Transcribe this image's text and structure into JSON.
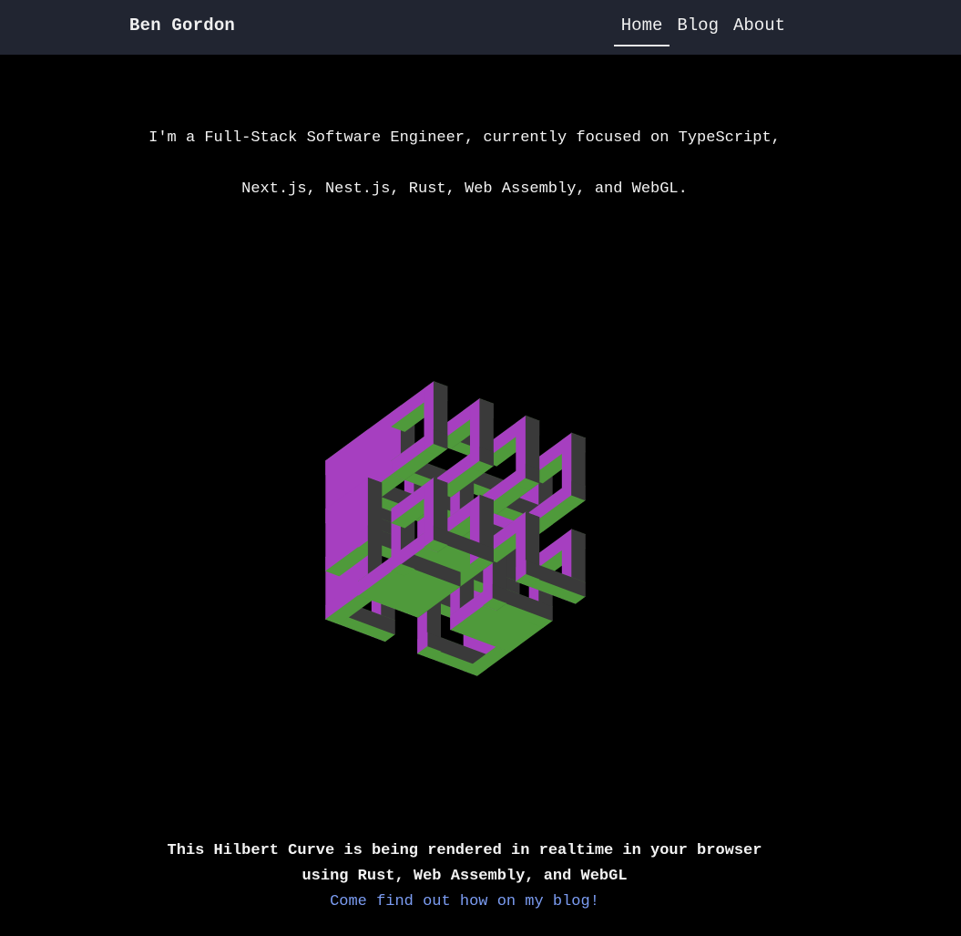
{
  "header": {
    "brand": "Ben Gordon",
    "nav": [
      {
        "label": "Home",
        "active": true
      },
      {
        "label": "Blog",
        "active": false
      },
      {
        "label": "About",
        "active": false
      }
    ]
  },
  "intro": {
    "line1": "I'm a Full-Stack Software Engineer, currently focused on TypeScript,",
    "line2": "Next.js, Nest.js, Rust, Web Assembly, and WebGL."
  },
  "visualization": {
    "colors": {
      "top": "#4f9a3b",
      "left": "#a63fc0",
      "right": "#3a3a3a"
    }
  },
  "caption": {
    "line1": "This Hilbert Curve is being rendered in realtime in your browser",
    "line2": "using Rust, Web Assembly, and WebGL",
    "link": "Come find out how on my blog!",
    "link_color": "#7b9cf2"
  }
}
